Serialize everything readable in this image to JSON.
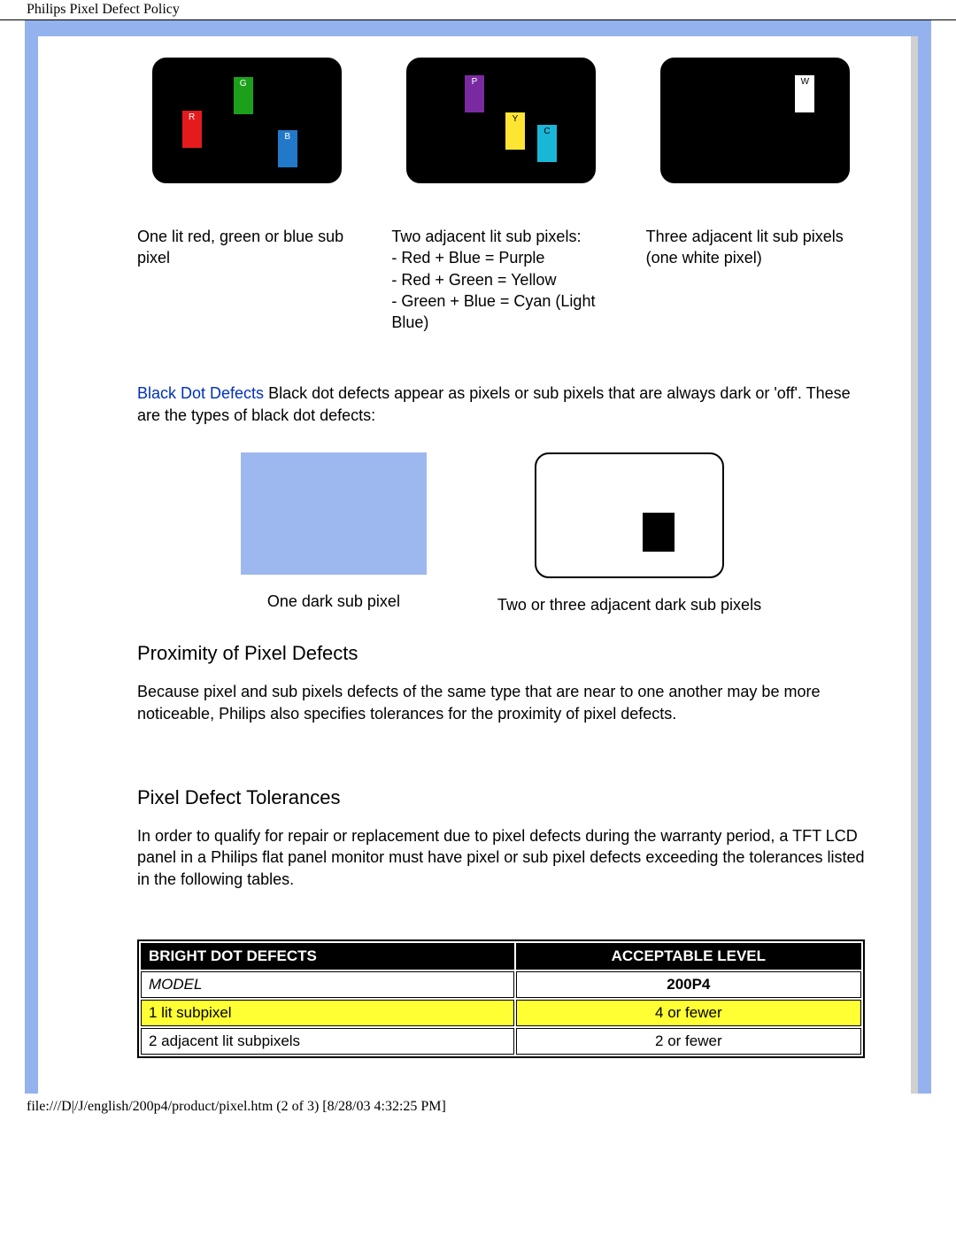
{
  "doc_title": "Philips Pixel Defect Policy",
  "bright": {
    "col1": "One lit red, green or blue sub pixel",
    "col2_l1": "Two adjacent lit sub pixels:",
    "col2_l2": "- Red + Blue = Purple",
    "col2_l3": "- Red + Green = Yellow",
    "col2_l4": "- Green + Blue = Cyan (Light Blue)",
    "col3_l1": "Three adjacent lit sub pixels",
    "col3_l2": "(one white pixel)"
  },
  "labels": {
    "R": "R",
    "G": "G",
    "B": "B",
    "P": "P",
    "Y": "Y",
    "C": "C",
    "W": "W"
  },
  "black": {
    "title": "Black Dot Defects",
    "text": " Black dot defects appear as pixels or sub pixels that are always dark or 'off'. These are the types of black dot defects:",
    "cap1": "One dark sub pixel",
    "cap2": "Two or three adjacent dark sub pixels"
  },
  "proximity": {
    "heading": "Proximity of Pixel Defects",
    "text": "Because pixel and sub pixels defects of the same type that are near to one another may be more noticeable, Philips also specifies tolerances for the proximity of pixel defects."
  },
  "tolerances": {
    "heading": "Pixel Defect Tolerances",
    "text": "In order to qualify for repair or replacement due to pixel defects during the warranty period, a TFT LCD panel in a Philips flat panel monitor must have pixel or sub pixel defects exceeding the tolerances listed in the following tables."
  },
  "table": {
    "h1": "BRIGHT DOT DEFECTS",
    "h2": "ACCEPTABLE LEVEL",
    "model_label": "MODEL",
    "model_value": "200P4",
    "rows": [
      {
        "name": "1 lit subpixel",
        "value": "4 or fewer"
      },
      {
        "name": "2 adjacent lit subpixels",
        "value": "2 or fewer"
      }
    ]
  },
  "footer": "file:///D|/J/english/200p4/product/pixel.htm (2 of 3) [8/28/03 4:32:25 PM]"
}
